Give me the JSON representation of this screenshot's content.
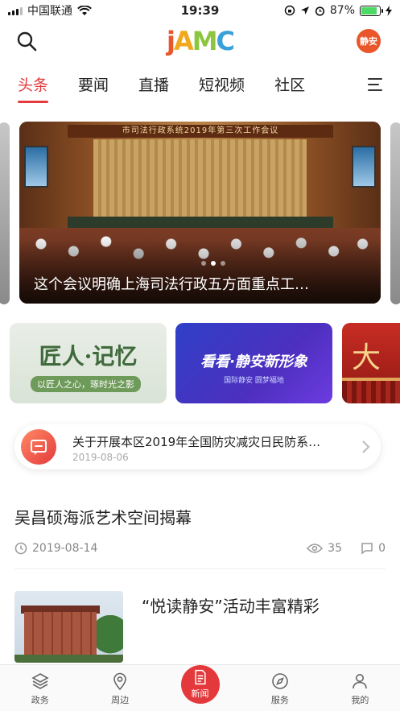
{
  "status_bar": {
    "carrier": "中国联通",
    "time": "19:39",
    "battery": "87%",
    "battery_level": 0.87
  },
  "header": {
    "logo_letters": [
      "j",
      "A",
      "M",
      "C"
    ],
    "avatar_text": "静安"
  },
  "tabs": [
    {
      "label": "头条",
      "active": true
    },
    {
      "label": "要闻",
      "active": false
    },
    {
      "label": "直播",
      "active": false
    },
    {
      "label": "短视频",
      "active": false
    },
    {
      "label": "社区",
      "active": false
    }
  ],
  "banner": {
    "sign_text": "市司法行政系统2019年第三次工作会议",
    "caption": "这个会议明确上海司法行政五方面重点工…",
    "slide_count": 3,
    "current_slide": 1
  },
  "promos": [
    {
      "title": "匠人·记忆",
      "subtitle": "以匠人之心，琢时光之影"
    },
    {
      "title": "看看·静安新形象",
      "subtitle": "国际静安 圆梦福地"
    },
    {
      "title": "大"
    }
  ],
  "notice": {
    "title": "关于开展本区2019年全国防灾减灾日民防系…",
    "date": "2019-08-06"
  },
  "articles": [
    {
      "title": "吴昌硕海派艺术空间揭幕",
      "date": "2019-08-14",
      "views": "35",
      "comments": "0"
    },
    {
      "title": "“悦读静安”活动丰富精彩"
    }
  ],
  "tabbar": [
    {
      "label": "政务",
      "icon": "layers-icon"
    },
    {
      "label": "周边",
      "icon": "location-pin-icon"
    },
    {
      "label": "新闻",
      "icon": "news-document-icon",
      "active": true
    },
    {
      "label": "服务",
      "icon": "compass-icon"
    },
    {
      "label": "我的",
      "icon": "person-icon"
    }
  ],
  "colors": {
    "accent": "#e4393c",
    "logo": [
      "#e8562a",
      "#f2a81d",
      "#8cc63f",
      "#3aa0d8"
    ]
  }
}
